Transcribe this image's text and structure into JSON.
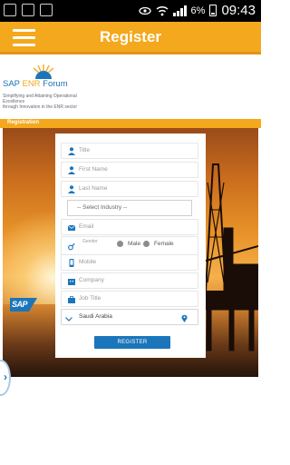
{
  "statusbar": {
    "battery": "6%",
    "time": "09:43",
    "left_icons": [
      "bbm-icon",
      "image-icon",
      "store-icon"
    ],
    "right_icons": [
      "eye-icon",
      "wifi-icon",
      "signal-icon",
      "battery-icon"
    ]
  },
  "header": {
    "title": "Register"
  },
  "brand": {
    "name_a": "SAP ",
    "name_b": "ENR",
    "name_c": " Forum",
    "tagline_1": "Simplifying and Attaining Operational",
    "tagline_2": "Excellence",
    "tagline_3": "through Innovation in the ENR sector"
  },
  "section": {
    "label": "Registration"
  },
  "hero": {
    "sap_logo": "SAP"
  },
  "form": {
    "title_placeholder": "Title",
    "first_name_placeholder": "First Name",
    "last_name_placeholder": "Last Name",
    "industry_select": "-- Select Industry --",
    "email_placeholder": "Email",
    "gender_label": "Gender",
    "male_label": "Male",
    "female_label": "Female",
    "mobile_placeholder": "Mobile",
    "company_placeholder": "Company",
    "job_title_placeholder": "Job Title",
    "country_value": "Saudi Arabia",
    "register_label": "REGISTER"
  },
  "side_tab": {
    "glyph": "›"
  },
  "colors": {
    "accent": "#f4a81d",
    "brand_blue": "#1b75bb"
  }
}
